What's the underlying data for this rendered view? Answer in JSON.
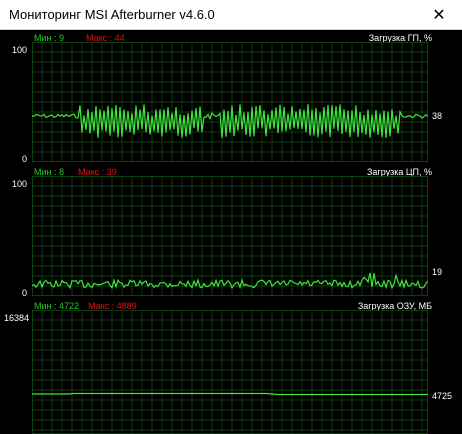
{
  "window": {
    "title": "Мониторинг MSI Afterburner v4.6.0",
    "close_glyph": "✕"
  },
  "graphs": [
    {
      "title": "Загрузка ГП, %",
      "min_label": "Мин : 9",
      "max_label": "Макс : 44",
      "axis_max": "100",
      "axis_min": "0",
      "current": "38",
      "line_color": "#3ee63e",
      "grid_color": "#0d3d0d"
    },
    {
      "title": "Загрузка ЦП, %",
      "min_label": "Мин : 8",
      "max_label": "Макс : 39",
      "axis_max": "100",
      "axis_min": "0",
      "current": "19",
      "line_color": "#3ee63e",
      "grid_color": "#0d3d0d"
    },
    {
      "title": "Загрузка ОЗУ, МБ",
      "min_label": "Мин : 4722",
      "max_label": "Макс : 4889",
      "axis_max": "16384",
      "axis_min": "",
      "current": "4725",
      "line_color": "#3ee63e",
      "grid_color": "#0d3d0d"
    }
  ]
}
